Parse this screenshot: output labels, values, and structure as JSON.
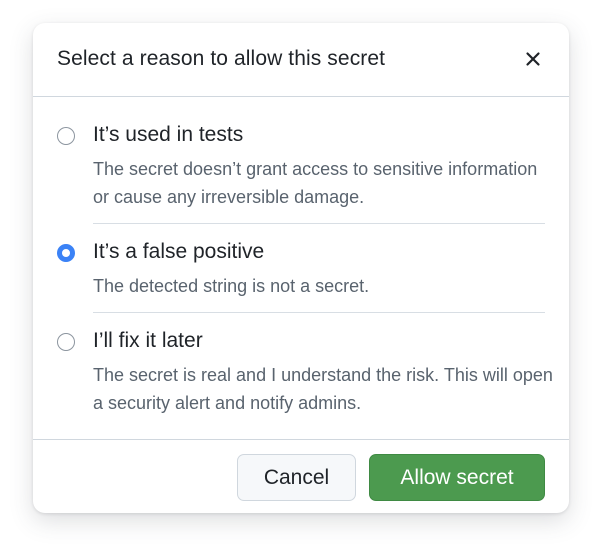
{
  "dialog": {
    "title": "Select a reason to allow this secret",
    "close_icon": "close-icon"
  },
  "options": [
    {
      "label": "It’s used in tests",
      "description": "The secret doesn’t grant access to sensitive information or cause any irreversible damage.",
      "selected": false
    },
    {
      "label": "It’s a false positive",
      "description": "The detected string is not a secret.",
      "selected": true
    },
    {
      "label": "I’ll fix it later",
      "description": "The secret is real and I understand the risk. This will open a security alert and notify admins.",
      "selected": false
    }
  ],
  "footer": {
    "cancel_label": "Cancel",
    "allow_label": "Allow secret"
  },
  "colors": {
    "radio_selected": "#3b82f6",
    "allow_button": "#4c9a4f",
    "text_primary": "#1f2328",
    "text_secondary": "#59636e"
  }
}
